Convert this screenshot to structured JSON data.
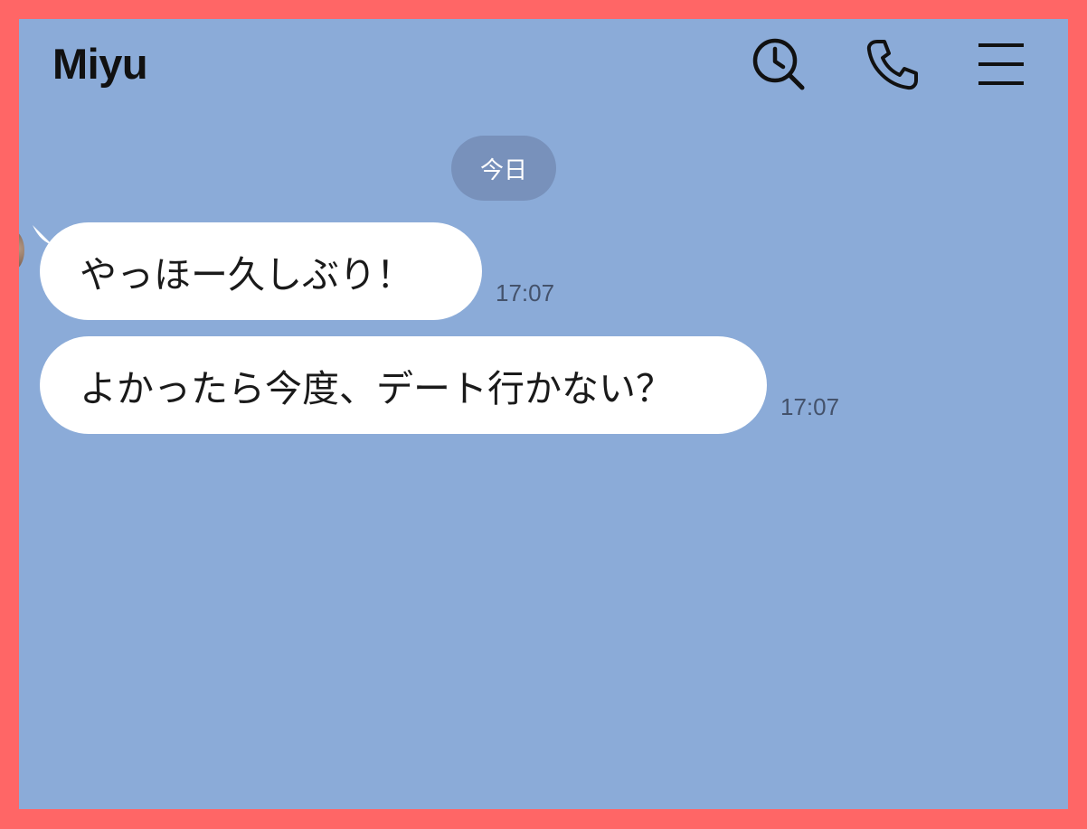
{
  "chat": {
    "contact_name": "Miyu",
    "date_separator": "今日"
  },
  "header": {
    "icons": [
      "search-clock-icon",
      "phone-icon",
      "menu-icon"
    ]
  },
  "messages": [
    {
      "text": "やっほー久しぶり！",
      "time": "17:07",
      "sender": "Miyu"
    },
    {
      "text": "よかったら今度、デート行かない？",
      "time": "17:07",
      "sender": "Miyu"
    }
  ],
  "colors": {
    "frame": "#FF6666",
    "chat_background": "#8BABD8",
    "bubble": "#FFFFFF",
    "date_pill": "#7891BB"
  }
}
